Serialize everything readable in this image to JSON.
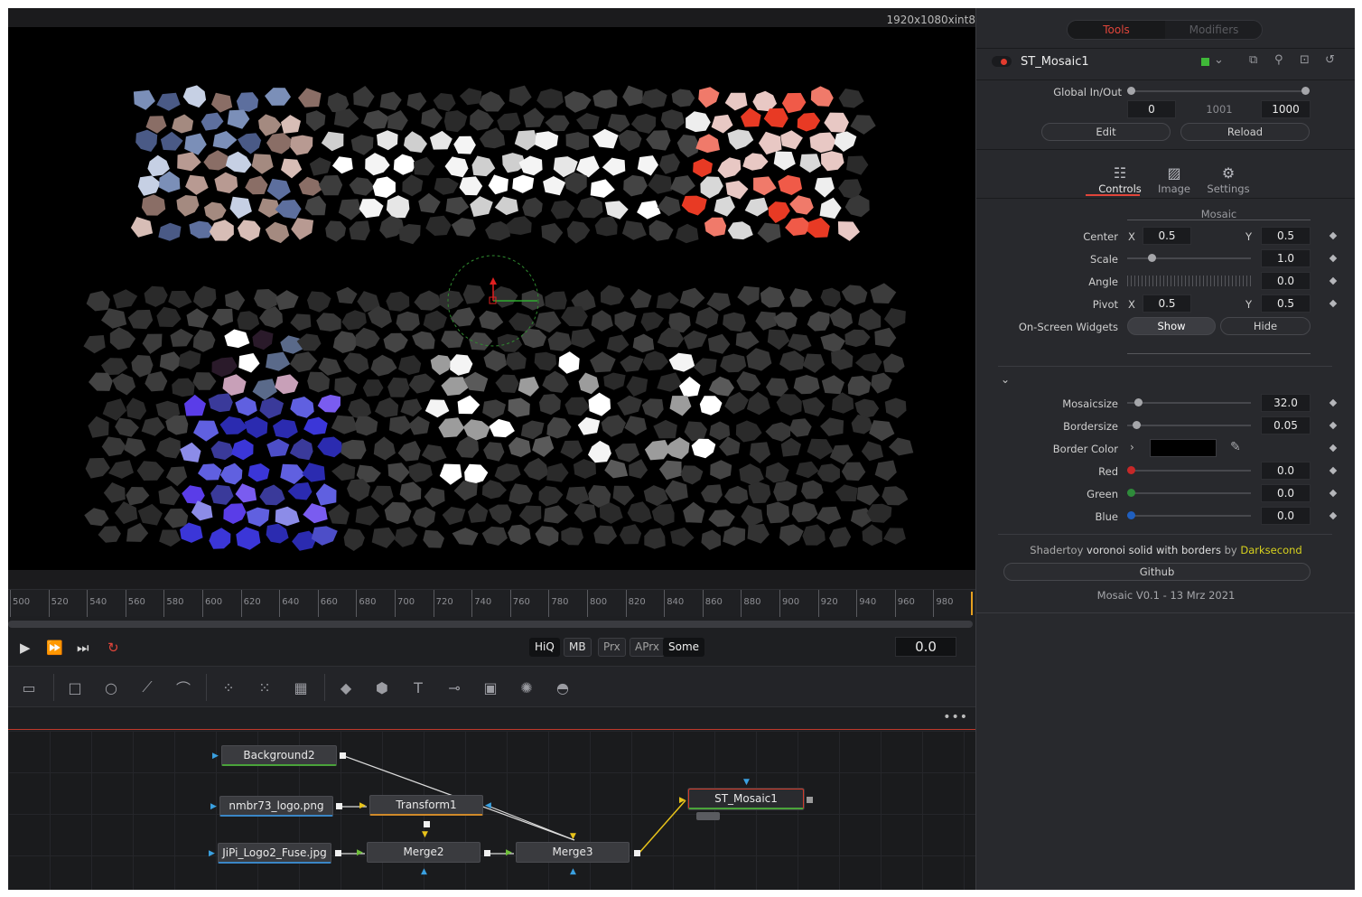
{
  "viewer": {
    "resolution": "1920x1080xint8",
    "timeline_ticks": [
      "500",
      "520",
      "540",
      "560",
      "580",
      "600",
      "620",
      "640",
      "660",
      "680",
      "700",
      "720",
      "740",
      "760",
      "780",
      "800",
      "820",
      "840",
      "860",
      "880",
      "900",
      "920",
      "940",
      "960",
      "980"
    ]
  },
  "transport": {
    "buttons": [
      "play-icon",
      "fast-forward-icon",
      "skip-to-end-icon",
      "loop-icon"
    ],
    "quality": [
      "HiQ",
      "MB",
      "Prx",
      "APrx",
      "Some"
    ],
    "time": "0.0"
  },
  "toolbar": {
    "tools": [
      "background-icon",
      "rectangle-mask-icon",
      "ellipse-mask-icon",
      "polygon-mask-icon",
      "bspline-mask-icon",
      "particle-emitter-icon",
      "particle-render-icon",
      "particle-effect-icon",
      "image-plane-3d-icon",
      "shape-3d-icon",
      "text-3d-icon",
      "merge-3d-icon",
      "camera-3d-icon",
      "renderer-3d-icon",
      "light-3d-icon"
    ]
  },
  "flow": {
    "menu": "•••",
    "nodes": {
      "background2": "Background2",
      "logo_png": "nmbr73_logo.png",
      "transform1": "Transform1",
      "jipi_jpg": "JiPi_Logo2_Fuse.jpg",
      "merge2": "Merge2",
      "merge3": "Merge3",
      "mosaic": "ST_Mosaic1"
    }
  },
  "inspector": {
    "tabs": {
      "tools": "Tools",
      "modifiers": "Modifiers"
    },
    "tool_name": "ST_Mosaic1",
    "global": {
      "label": "Global In/Out",
      "in": "0",
      "mid": "1001",
      "out": "1000",
      "edit": "Edit",
      "reload": "Reload"
    },
    "panel_tabs": {
      "controls": "Controls",
      "image": "Image",
      "settings": "Settings"
    },
    "mosaic": {
      "section": "Mosaic",
      "center_label": "Center",
      "center_x": "0.5",
      "center_y": "0.5",
      "scale_label": "Scale",
      "scale": "1.0",
      "angle_label": "Angle",
      "angle": "0.0",
      "pivot_label": "Pivot",
      "pivot_x": "0.5",
      "pivot_y": "0.5",
      "widgets_label": "On-Screen Widgets",
      "show": "Show",
      "hide": "Hide",
      "x": "X",
      "y": "Y"
    },
    "params": {
      "mosaicsize_label": "Mosaicsize",
      "mosaicsize": "32.0",
      "bordersize_label": "Bordersize",
      "bordersize": "0.05",
      "border_color_label": "Border Color",
      "red_label": "Red",
      "red": "0.0",
      "green_label": "Green",
      "green": "0.0",
      "blue_label": "Blue",
      "blue": "0.0"
    },
    "footer": {
      "shadertoy": "Shadertoy",
      "title": "voronoi solid with borders",
      "by": "by",
      "author": "Darksecond",
      "github": "Github",
      "version": "Mosaic V0.1 - 13 Mrz 2021"
    }
  },
  "colors": {
    "accent": "#e0453a",
    "author": "#d8d21e",
    "red": "#c62828",
    "green": "#2e8b3a",
    "blue": "#1f5fbf"
  }
}
